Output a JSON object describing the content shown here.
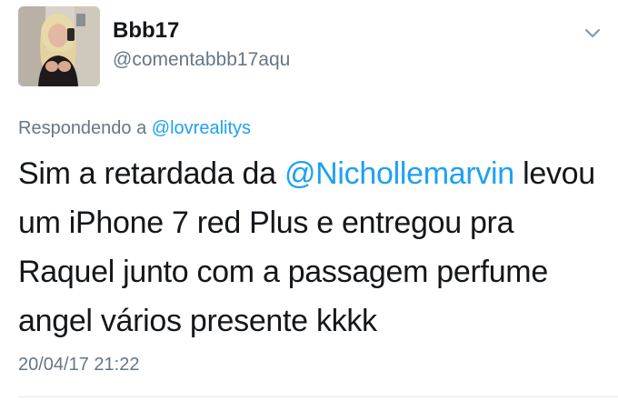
{
  "tweet": {
    "author": {
      "display_name": "Bbb17",
      "handle": "@comentabbb17aqu"
    },
    "reply": {
      "prefix": "Respondendo a",
      "mention": "@lovrealitys"
    },
    "text": {
      "line1_before": "Sim a retardada da",
      "line1_mention": "@Nichollemarvin",
      "line1_after": "levou",
      "line2": "um iPhone 7 red Plus e entregou pra",
      "line3": "Raquel junto com a passagem perfume",
      "line4": "angel vários presente kkkk"
    },
    "timestamp": "20/04/17 21:22",
    "menu_icon": "chevron-down-icon",
    "avatar_icon": "user-photo"
  },
  "colors": {
    "text": "#14171a",
    "secondary": "#657786",
    "link": "#1da1f2",
    "divider": "#e1e8ed"
  }
}
